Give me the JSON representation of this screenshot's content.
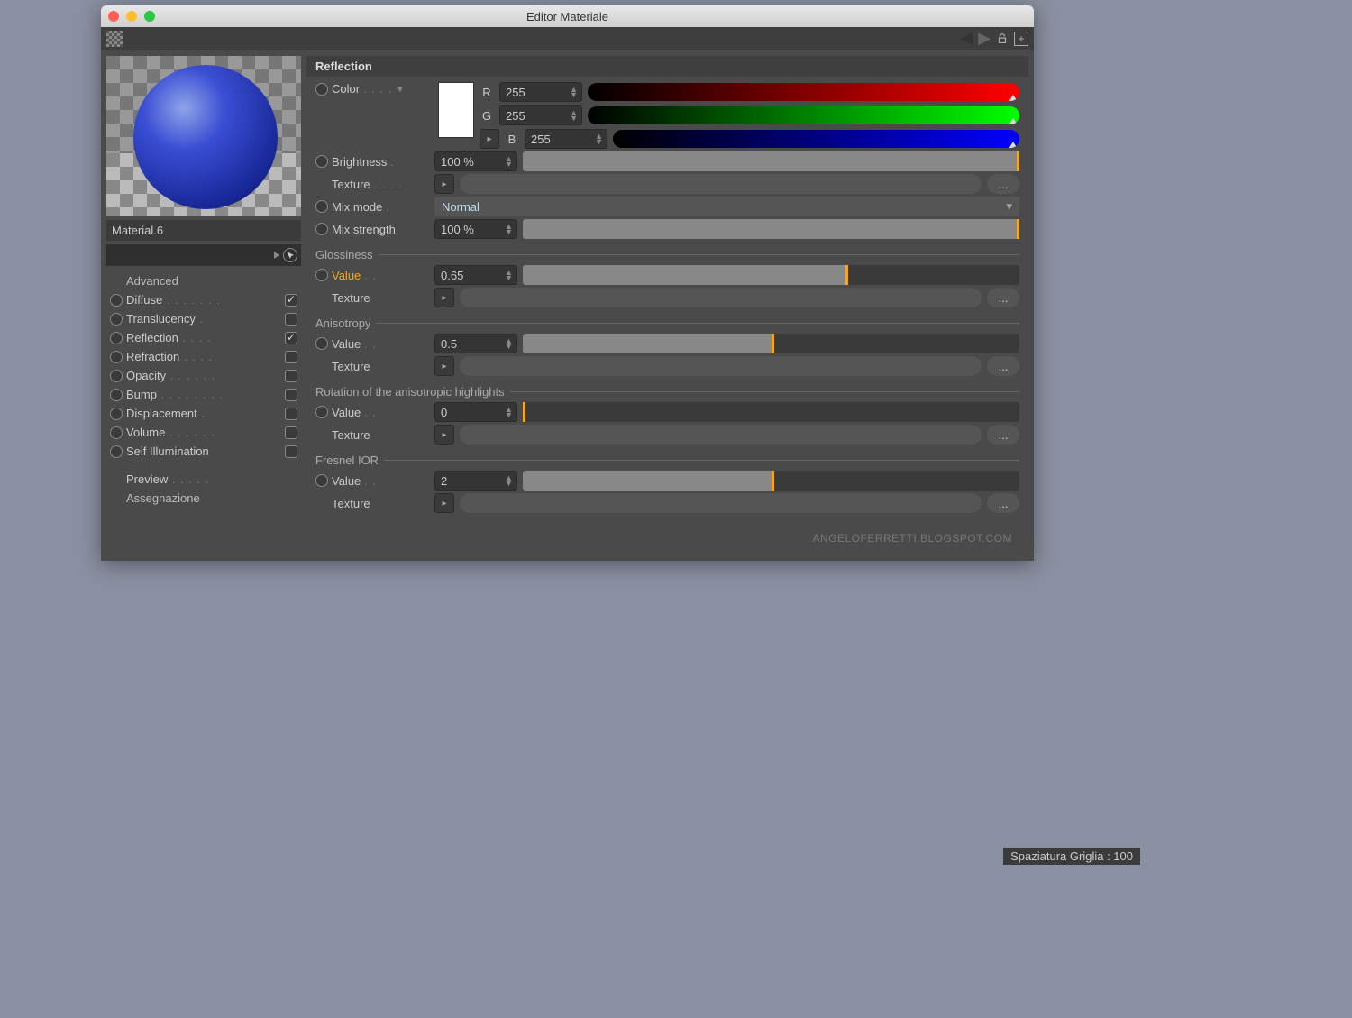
{
  "window": {
    "title": "Editor Materiale"
  },
  "status": {
    "grid_spacing": "Spaziatura Griglia : 100"
  },
  "material": {
    "name": "Material.6"
  },
  "channels": {
    "advanced": "Advanced",
    "diffuse": "Diffuse",
    "translucency": "Translucency",
    "reflection": "Reflection",
    "refraction": "Refraction",
    "opacity": "Opacity",
    "bump": "Bump",
    "displacement": "Displacement",
    "volume": "Volume",
    "self_illumination": "Self Illumination",
    "preview": "Preview",
    "assignment": "Assegnazione"
  },
  "panel": {
    "header": "Reflection",
    "color_label": "Color",
    "color": {
      "r_label": "R",
      "g_label": "G",
      "b_label": "B",
      "r": "255",
      "g": "255",
      "b": "255"
    },
    "brightness_label": "Brightness",
    "brightness": "100 %",
    "texture_label": "Texture",
    "mix_mode_label": "Mix mode",
    "mix_mode": "Normal",
    "mix_strength_label": "Mix strength",
    "mix_strength": "100 %",
    "glossiness_group": "Glossiness",
    "value_label": "Value",
    "glossiness": "0.65",
    "anisotropy_group": "Anisotropy",
    "anisotropy": "0.5",
    "rotation_group": "Rotation of the anisotropic highlights",
    "rotation": "0",
    "fresnel_group": "Fresnel IOR",
    "fresnel": "2",
    "credit": "ANGELOFERRETTI.BLOGSPOT.COM"
  }
}
